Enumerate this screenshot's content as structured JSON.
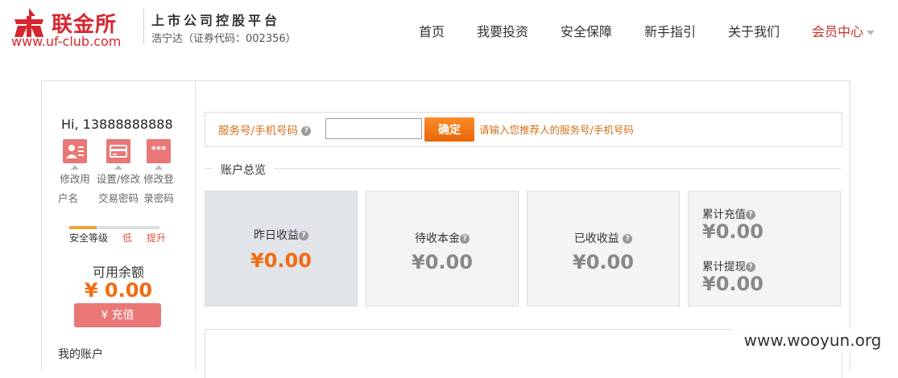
{
  "header": {
    "logo_cn": "联金所",
    "logo_url": "www.uf-club.com",
    "tagline": "上市公司控股平台",
    "stock": "浩宁达（证券代码：002356）",
    "nav": [
      {
        "label": "首页"
      },
      {
        "label": "我要投资"
      },
      {
        "label": "安全保障"
      },
      {
        "label": "新手指引"
      },
      {
        "label": "关于我们"
      },
      {
        "label": "会员中心"
      }
    ],
    "accent_color": "#d7262f"
  },
  "sidebar": {
    "greeting": "Hi, 13888888888",
    "tools": [
      {
        "label_1": "修改用",
        "label_2": "户名",
        "icon": "user-card-icon"
      },
      {
        "label_1": "设置/修改",
        "label_2": "交易密码",
        "icon": "credit-card-icon"
      },
      {
        "label_1": "修改登",
        "label_2": "录密码",
        "icon": "password-icon",
        "glyph": "***"
      }
    ],
    "security": {
      "label": "安全等级",
      "level": "低",
      "upgrade": "提升",
      "level_fraction": 0.3
    },
    "available_label": "可用余额",
    "available_value": "¥ 0.00",
    "recharge_label": "¥ 充值",
    "my_account": "我的账户"
  },
  "referrer": {
    "label": "服务号/手机号码",
    "input_value": "",
    "confirm_label": "确定",
    "hint": "请输入您推荐人的服务号/手机号码"
  },
  "overview": {
    "title": "账户总览",
    "cards": [
      {
        "label": "昨日收益",
        "value": "¥0.00"
      },
      {
        "label": "待收本金",
        "value": "¥0.00"
      },
      {
        "label": "已收收益",
        "value": "¥0.00"
      }
    ],
    "recharge_total_label": "累计充值",
    "recharge_total_value": "¥0.00",
    "withdraw_total_label": "累计提现",
    "withdraw_total_value": "¥0.00"
  },
  "watermark": "www.wooyun.org"
}
